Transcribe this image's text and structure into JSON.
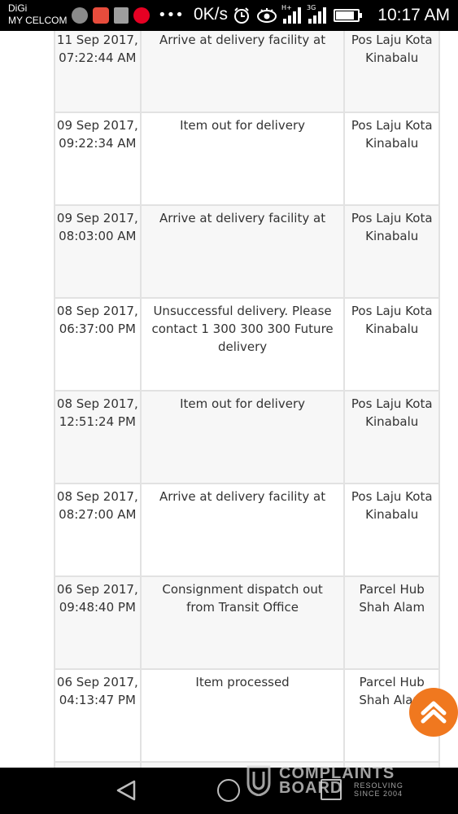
{
  "status_bar": {
    "carrier_line1": "DiGi",
    "carrier_line2": "MY CELCOM",
    "overflow_indicator": "•••",
    "net_speed": "0K/s",
    "network_hplus": "H+",
    "network_3g": "3G",
    "battery_level_percent": 85,
    "time": "10:17 AM",
    "icons": [
      "app-notification-icon",
      "email-app-icon",
      "gallery-icon",
      "pinterest-icon",
      "alarm-icon",
      "eye-comfort-icon",
      "signal-icon",
      "battery-icon"
    ]
  },
  "tracking": {
    "rows": [
      {
        "date": "11 Sep 2017, 07:22:44 AM",
        "event": "Arrive at delivery facility at",
        "location": "Pos Laju Kota Kinabalu"
      },
      {
        "date": "09 Sep 2017, 09:22:34 AM",
        "event": "Item out for delivery",
        "location": "Pos Laju Kota Kinabalu"
      },
      {
        "date": "09 Sep 2017, 08:03:00 AM",
        "event": "Arrive at delivery facility at",
        "location": "Pos Laju Kota Kinabalu"
      },
      {
        "date": "08 Sep 2017, 06:37:00 PM",
        "event": "Unsuccessful delivery. Please contact 1 300 300 300 Future delivery",
        "location": "Pos Laju Kota Kinabalu"
      },
      {
        "date": "08 Sep 2017, 12:51:24 PM",
        "event": "Item out for delivery",
        "location": "Pos Laju Kota Kinabalu"
      },
      {
        "date": "08 Sep 2017, 08:27:00 AM",
        "event": "Arrive at delivery facility at",
        "location": "Pos Laju Kota Kinabalu"
      },
      {
        "date": "06 Sep 2017, 09:48:40 PM",
        "event": "Consignment dispatch out from Transit Office",
        "location": "Parcel Hub Shah Alam"
      },
      {
        "date": "06 Sep 2017, 04:13:47 PM",
        "event": "Item processed",
        "location": "Parcel Hub Shah Alam"
      }
    ]
  },
  "scroll_top_button": {
    "icon": "chevron-up-icon",
    "color": "#f0781f"
  },
  "nav_bar": {
    "icons": [
      "back-icon",
      "home-icon",
      "recent-apps-icon"
    ]
  },
  "watermark": {
    "line1": "COMPLAINTS",
    "line2": "BOARD",
    "tagline": "RESOLVING SINCE 2004"
  },
  "colors": {
    "row_alt": "#f7f7f7",
    "border": "#e2e2e2",
    "text": "#333333",
    "accent": "#f0781f"
  }
}
